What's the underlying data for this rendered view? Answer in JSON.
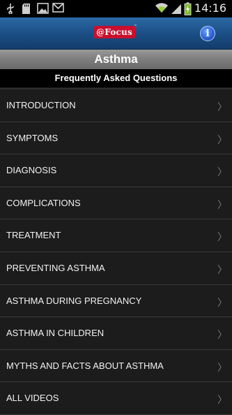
{
  "status_bar": {
    "time": "14:16",
    "icons": [
      "usb-icon",
      "sd-card-icon",
      "image-icon",
      "gmail-icon",
      "wifi-icon",
      "signal-icon",
      "battery-charging-icon"
    ]
  },
  "header": {
    "logo_text": "@Focus",
    "logo_tm": "™",
    "info_label": "i"
  },
  "page": {
    "title": "Asthma",
    "subtitle": "Frequently Asked Questions"
  },
  "list": {
    "items": [
      {
        "label": "INTRODUCTION"
      },
      {
        "label": "SYMPTOMS"
      },
      {
        "label": "DIAGNOSIS"
      },
      {
        "label": "COMPLICATIONS"
      },
      {
        "label": "TREATMENT"
      },
      {
        "label": "PREVENTING ASTHMA"
      },
      {
        "label": "ASTHMA DURING PREGNANCY"
      },
      {
        "label": "ASTHMA IN CHILDREN"
      },
      {
        "label": "MYTHS AND FACTS ABOUT ASTHMA"
      },
      {
        "label": "ALL VIDEOS"
      }
    ],
    "chevron": "〉"
  },
  "colors": {
    "header_blue": "#1b4f86",
    "title_gray": "#7f7f7f",
    "list_bg": "#1c1c1c",
    "divider": "#3a3a3a",
    "logo_red": "#c8102e"
  }
}
